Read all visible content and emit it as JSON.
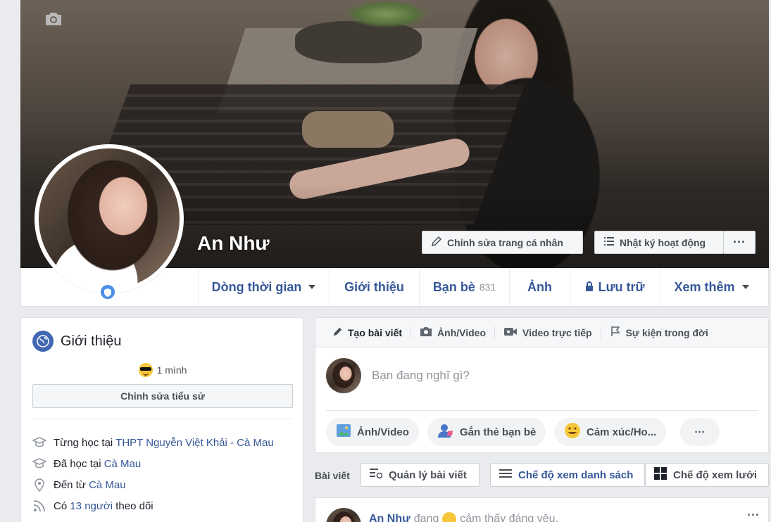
{
  "profile": {
    "name": "An Như",
    "edit_profile_label": "Chỉnh sửa trang cá nhân",
    "activity_log_label": "Nhật ký hoạt động",
    "more_label": "···"
  },
  "nav": {
    "timeline": "Dòng thời gian",
    "about": "Giới thiệu",
    "friends": "Bạn bè",
    "friends_count": "831",
    "photos": "Ảnh",
    "archive": "Lưu trữ",
    "more": "Xem thêm"
  },
  "intro": {
    "title": "Giới thiệu",
    "bio": "1 mình",
    "edit_bio_label": "Chỉnh sửa tiểu sử",
    "items": [
      {
        "icon": "graduation-cap-icon",
        "prefix": "Từng học tại ",
        "link": "THPT Nguyễn Việt Khải - Cà Mau",
        "suffix": ""
      },
      {
        "icon": "graduation-cap-icon",
        "prefix": "Đã học tại ",
        "link": "Cà Mau",
        "suffix": ""
      },
      {
        "icon": "location-pin-icon",
        "prefix": "Đến từ ",
        "link": "Cà Mau",
        "suffix": ""
      },
      {
        "icon": "rss-icon",
        "prefix": "Có ",
        "link": "13 người",
        "suffix": " theo dõi"
      }
    ]
  },
  "composer": {
    "tabs": [
      "Tạo bài viết",
      "Ảnh/Video",
      "Video trực tiếp",
      "Sự kiện trong đời"
    ],
    "placeholder": "Bạn đang nghĩ gì?",
    "actions": [
      "Ảnh/Video",
      "Gắn thẻ bạn bè",
      "Cảm xúc/Ho...",
      "···"
    ]
  },
  "posts_toolbar": {
    "label": "Bài viết",
    "manage": "Quản lý bài viết",
    "list_view": "Chế độ xem danh sách",
    "grid_view": "Chế độ xem lưới"
  },
  "post": {
    "author": "An Như",
    "status_prefix": "đang",
    "status_text": "cảm thấy đáng yêu.",
    "more": "···"
  },
  "colors": {
    "link": "#365899",
    "background": "#e9ebee",
    "brand": "#4267b2"
  }
}
